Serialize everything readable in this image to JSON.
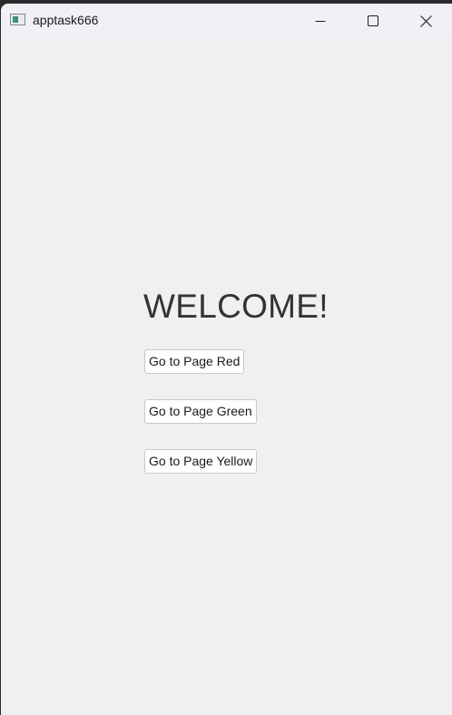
{
  "window": {
    "title": "apptask666",
    "controls": {
      "minimize": "minimize-icon",
      "maximize": "maximize-icon",
      "close": "close-icon"
    }
  },
  "main": {
    "heading": "WELCOME!",
    "buttons": [
      {
        "label": "Go to Page Red"
      },
      {
        "label": "Go to Page Green"
      },
      {
        "label": "Go to Page Yellow"
      }
    ]
  },
  "colors": {
    "titlebar_bg": "#f3eff7",
    "window_bg": "#f0f0f0",
    "heading_text": "#333333",
    "button_bg": "#ffffff",
    "button_border": "#c9c9c9"
  }
}
